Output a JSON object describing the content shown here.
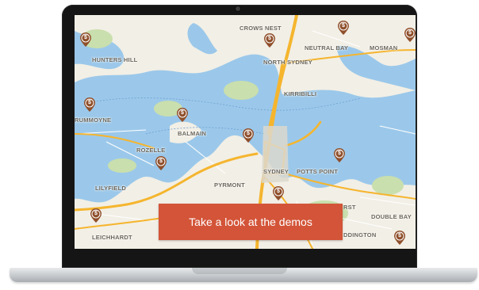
{
  "map": {
    "labels": {
      "crows_nest": "CROWS NEST",
      "neutral_bay": "NEUTRAL BAY",
      "mosman": "MOSMAN",
      "hunters_hill": "HUNTERS HILL",
      "north_sydney": "NORTH SYDNEY",
      "kirribilli": "KIRRIBILLI",
      "drummoyne": "RUMMOYNE",
      "balmain": "BALMAIN",
      "rozelle": "ROZELLE",
      "sydney": "SYDNEY",
      "potts_point": "POTTS POINT",
      "lilyfield": "LILYFIELD",
      "pyrmont": "PYRMONT",
      "rst": "RST",
      "double_bay": "DOUBLE BAY",
      "leichhardt": "LEICHHARDT",
      "paddington": "DDINGTON"
    },
    "marker_symbol": "$",
    "colors": {
      "water": "#9bc8ea",
      "land": "#f2efe6",
      "park": "#c9dfad",
      "road": "#f5b52e",
      "marker": "#8f4f2b"
    }
  },
  "cta": {
    "label": "Take a look at the demos",
    "color": "#d35438"
  }
}
